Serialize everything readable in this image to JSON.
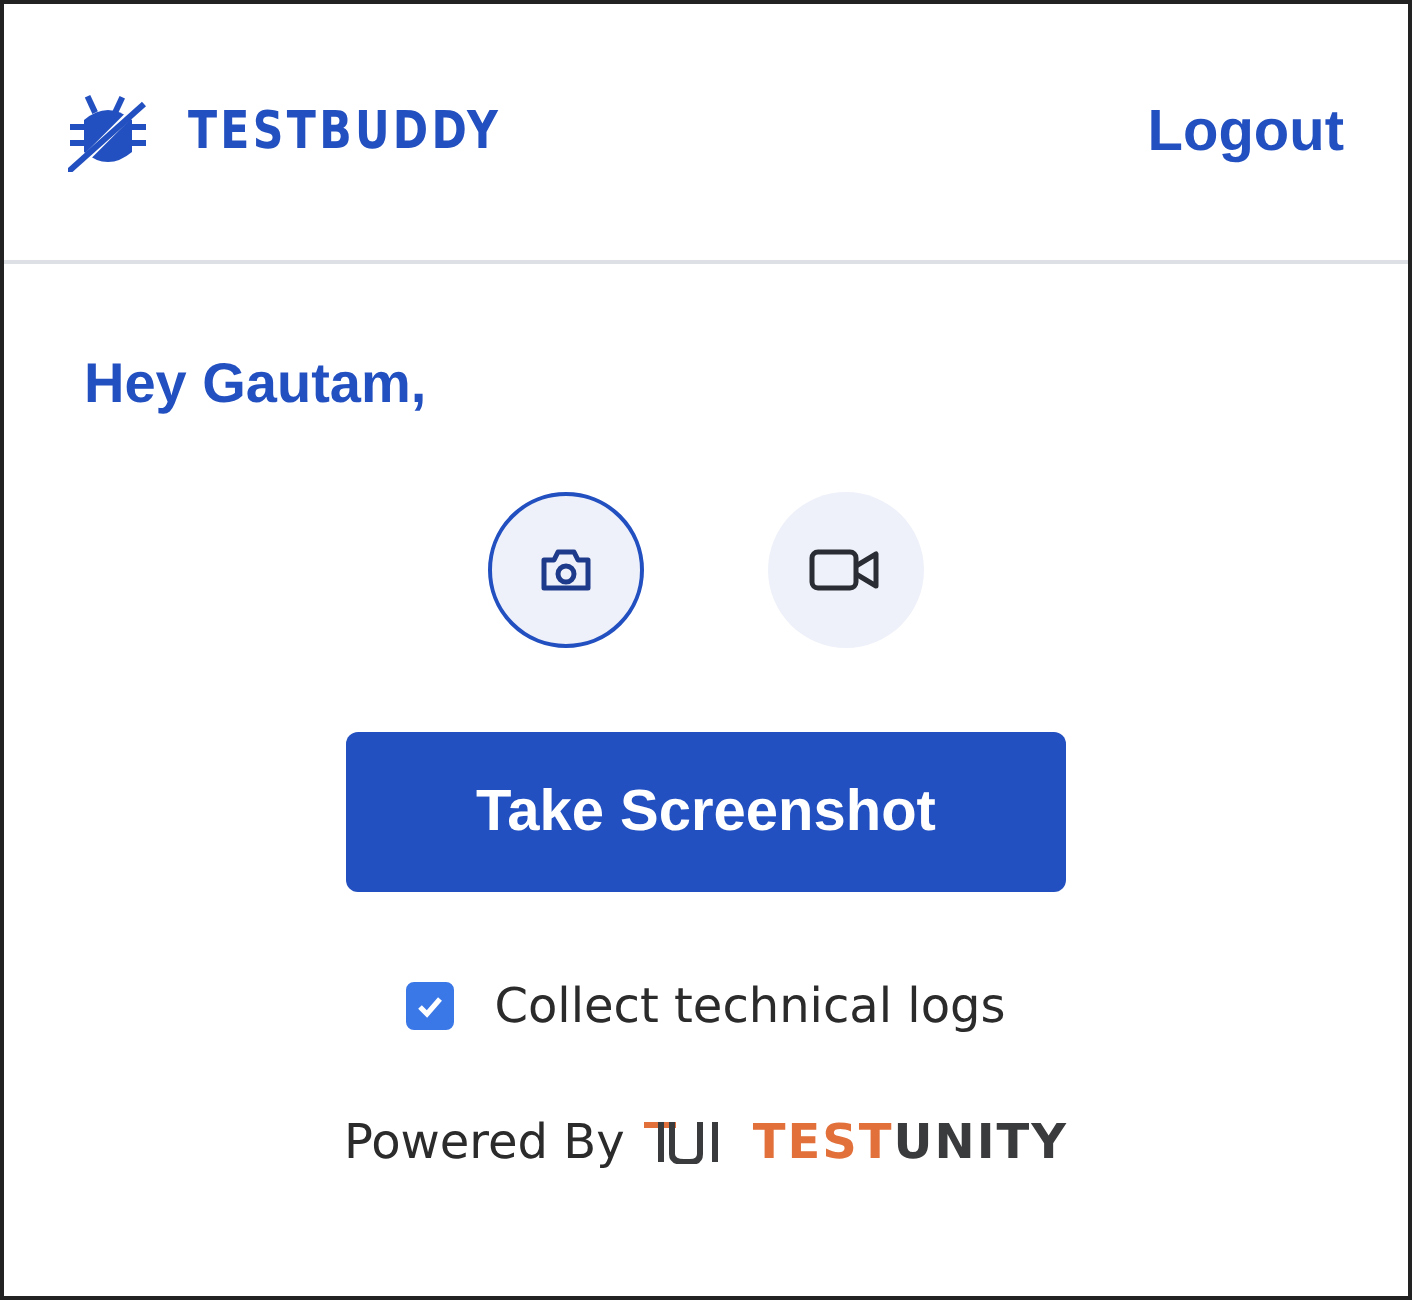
{
  "header": {
    "brand": "TESTBUDDY",
    "logout": "Logout"
  },
  "greeting": "Hey Gautam,",
  "modes": [
    {
      "kind": "camera",
      "selected": true
    },
    {
      "kind": "video",
      "selected": false
    }
  ],
  "action_button": "Take Screenshot",
  "collect_logs": {
    "label": "Collect technical logs",
    "checked": true
  },
  "footer": {
    "text": "Powered By",
    "logo_parts": [
      {
        "text": "TEST",
        "color": "#e2703a"
      },
      {
        "text": "UNITY",
        "color": "#3a3b3c"
      }
    ]
  }
}
